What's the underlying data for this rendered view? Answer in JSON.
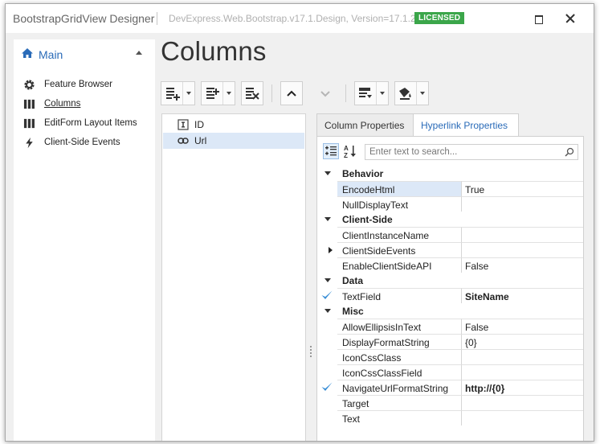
{
  "window": {
    "title": "BootstrapGridView Designer",
    "version": "DevExpress.Web.Bootstrap.v17.1.Design, Version=17.1.2.0",
    "license": "LICENSED",
    "colors": {
      "accent": "#2a6bb8",
      "license": "#3ba64a",
      "selection": "#dce8f7"
    }
  },
  "nav": {
    "title": "Main",
    "items": [
      {
        "label": "Feature Browser",
        "icon": "gear-icon"
      },
      {
        "label": "Columns",
        "icon": "columns-icon",
        "active": true
      },
      {
        "label": "EditForm Layout Items",
        "icon": "columns-icon"
      },
      {
        "label": "Client-Side Events",
        "icon": "lightning-icon"
      }
    ]
  },
  "page": {
    "title": "Columns"
  },
  "columns": [
    {
      "label": "ID",
      "icon": "text-field-icon"
    },
    {
      "label": "Url",
      "icon": "hyperlink-icon",
      "selected": true
    }
  ],
  "tabs": [
    {
      "label": "Column Properties"
    },
    {
      "label": "Hyperlink Properties",
      "active": true
    }
  ],
  "search": {
    "placeholder": "Enter text to search..."
  },
  "categories": {
    "behavior": "Behavior",
    "client_side": "Client-Side",
    "data": "Data",
    "misc": "Misc"
  },
  "properties": {
    "encode_html": {
      "name": "EncodeHtml",
      "value": "True"
    },
    "null_display_text": {
      "name": "NullDisplayText",
      "value": ""
    },
    "client_instance_name": {
      "name": "ClientInstanceName",
      "value": ""
    },
    "client_side_events": {
      "name": "ClientSideEvents",
      "value": ""
    },
    "enable_client_side_api": {
      "name": "EnableClientSideAPI",
      "value": "False"
    },
    "text_field": {
      "name": "TextField",
      "value": "SiteName"
    },
    "allow_ellipsis": {
      "name": "AllowEllipsisInText",
      "value": "False"
    },
    "display_format": {
      "name": "DisplayFormatString",
      "value": "{0}"
    },
    "icon_css_class": {
      "name": "IconCssClass",
      "value": ""
    },
    "icon_css_class_field": {
      "name": "IconCssClassField",
      "value": ""
    },
    "navigate_url_format": {
      "name": "NavigateUrlFormatString",
      "value": "http://{0}"
    },
    "target": {
      "name": "Target",
      "value": ""
    },
    "text": {
      "name": "Text",
      "value": ""
    }
  }
}
